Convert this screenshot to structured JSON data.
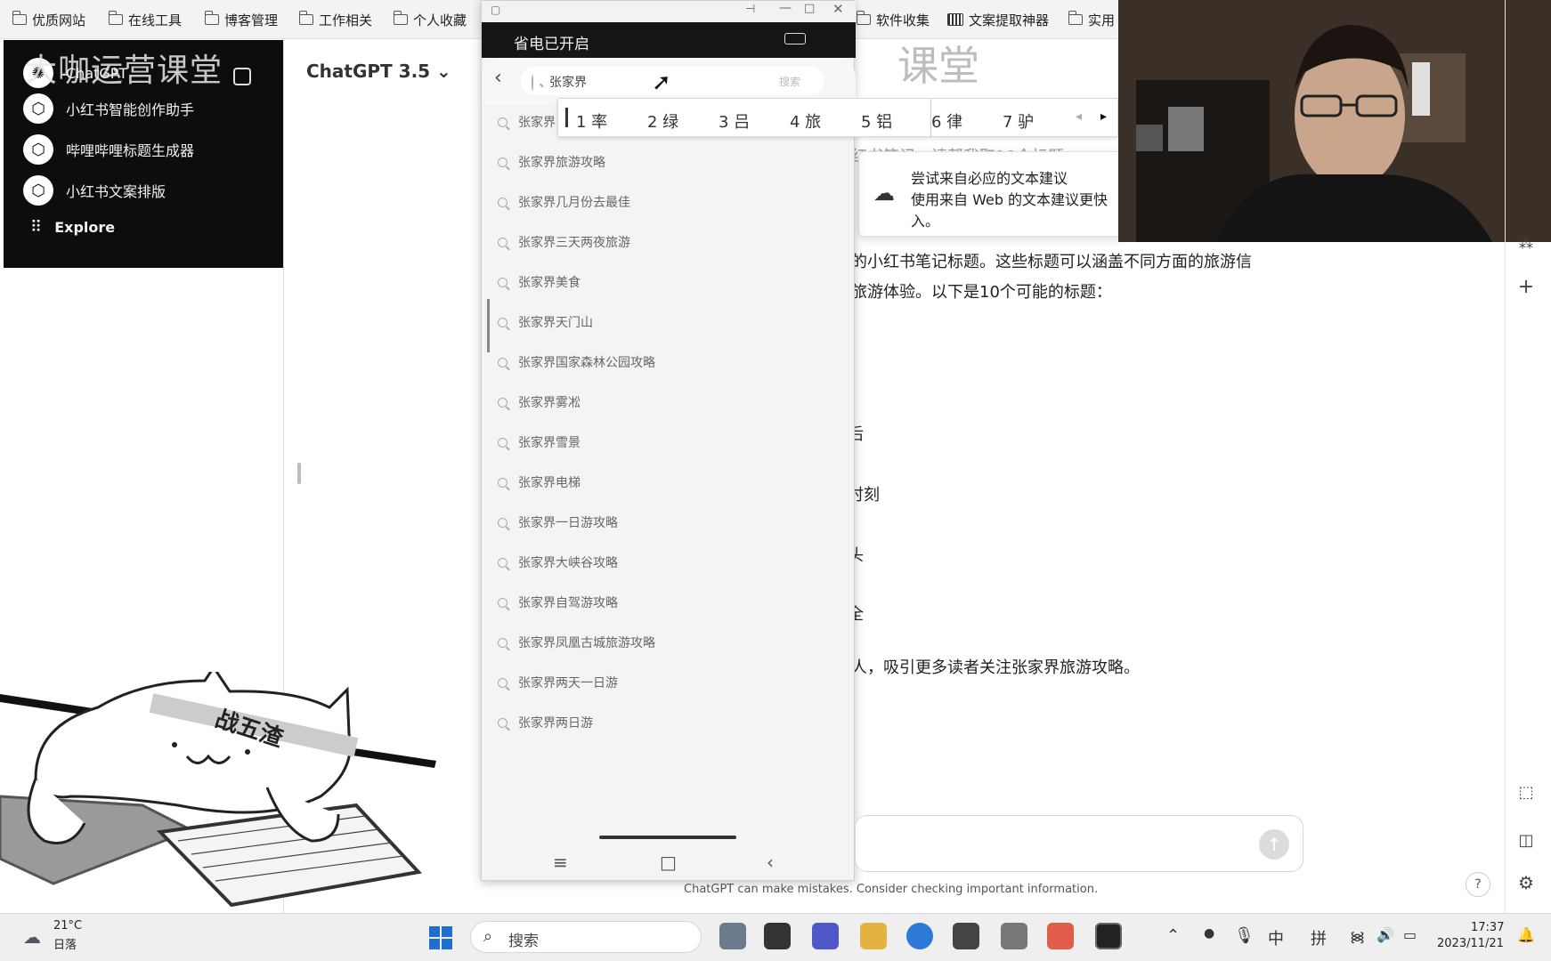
{
  "bookmarks": [
    "优质网站",
    "在线工具",
    "博客管理",
    "工作相关",
    "个人收藏",
    "软件收集",
    "文案提取神器",
    "实用"
  ],
  "sidebar": {
    "overlay_title": "大咖运营课堂",
    "items": [
      {
        "label": "ChatGPT",
        "icon": "chatgpt-logo-icon"
      },
      {
        "label": "小红书智能创作助手",
        "icon": "gpt-cube-icon"
      },
      {
        "label": "哔哩哔哩标题生成器",
        "icon": "gpt-cube-icon"
      },
      {
        "label": "小红书文案排版",
        "icon": "gpt-cube-icon"
      },
      {
        "label": "Explore",
        "icon": "grid-icon"
      }
    ]
  },
  "header": {
    "model": "ChatGPT 3.5 ⌄"
  },
  "brand_overlay": {
    "left": "大咖",
    "right": "课堂"
  },
  "phone": {
    "status": "省电已开启",
    "search_value": "张家界",
    "search_action": "搜索",
    "ime_candidates": [
      "1 率",
      "2 绿",
      "3 吕",
      "4 旅",
      "5 铝",
      "6 律",
      "7 驴"
    ],
    "suggestions": [
      "张家界",
      "张家界旅游攻略",
      "张家界几月份去最佳",
      "张家界三天两夜旅游",
      "张家界美食",
      "张家界天门山",
      "张家界国家森林公园攻略",
      "张家界雾凇",
      "张家界雪景",
      "张家界电梯",
      "张家界一日游攻略",
      "张家界大峡谷攻略",
      "张家界自驾游攻略",
      "张家界凤凰古城旅游攻略",
      "张家界两天一日游",
      "张家界两日游"
    ],
    "nav": [
      "≡",
      "□",
      "‹"
    ]
  },
  "chat": {
    "line0": "红书笔记，请帮我取10个标题",
    "line1": "的小红书笔记标题。这些标题可以涵盖不同方面的旅游信",
    "line2": "旅游体验。以下是10个可能的标题：",
    "frag1": "后",
    "frag2": "时刻",
    "frag3": "头",
    "frag4": "全",
    "line_end": "人，吸引更多读者关注张家界旅游攻略。",
    "disclaimer": "ChatGPT can make mistakes. Consider checking important information.",
    "send_icon": "↑",
    "help": "?"
  },
  "suggest_popup": {
    "title": "尝试来自必应的文本建议",
    "body": "使用来自 Web 的文本建议更快",
    "body2": "入。"
  },
  "cat_sticker": {
    "headband": "战五渣"
  },
  "taskbar": {
    "weather_temp": "21°C",
    "weather_desc": "日落",
    "search_placeholder": "搜索",
    "ime_lang": "中",
    "ime_mode": "拼",
    "time": "17:37",
    "date": "2023/11/21"
  }
}
